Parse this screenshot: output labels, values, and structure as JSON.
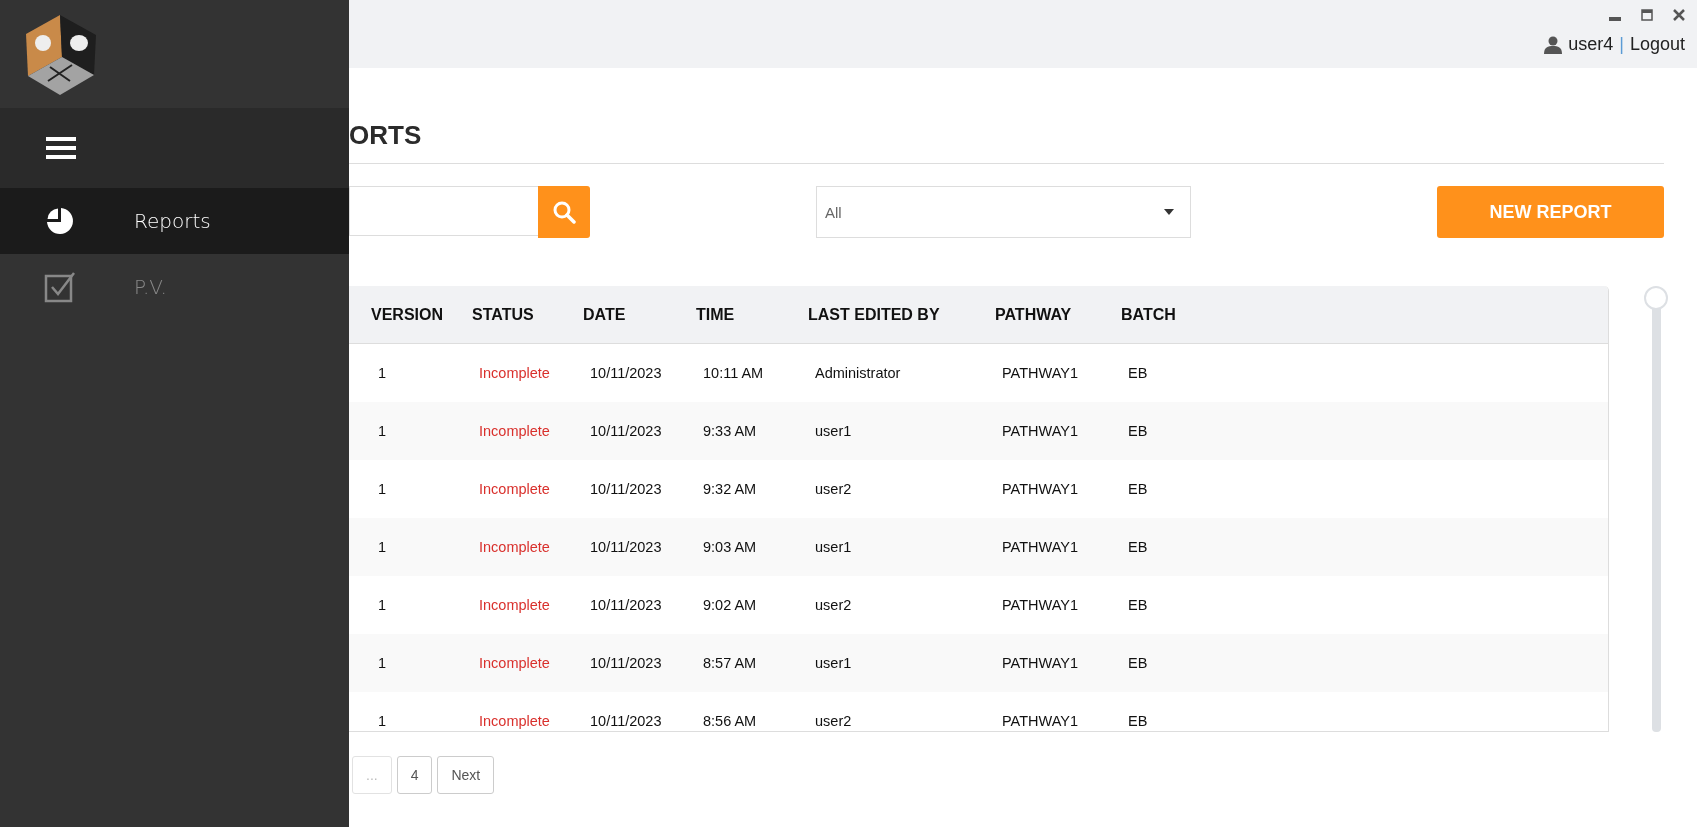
{
  "sidebar": {
    "items": [
      {
        "label": "Reports",
        "kind": "chart",
        "selected": true
      },
      {
        "label": "P.V.",
        "kind": "task",
        "selected": false
      }
    ]
  },
  "topbar": {
    "user": "user4",
    "separator": "|",
    "logout": "Logout"
  },
  "page": {
    "title": "ORTS"
  },
  "filter": {
    "value": "All"
  },
  "new_button": "NEW REPORT",
  "table": {
    "columns": [
      "VERSION",
      "STATUS",
      "DATE",
      "TIME",
      "LAST EDITED BY",
      "PATHWAY",
      "BATCH"
    ],
    "rows": [
      [
        "1",
        "Incomplete",
        "10/11/2023",
        "10:11 AM",
        "Administrator",
        "PATHWAY1",
        "EB"
      ],
      [
        "1",
        "Incomplete",
        "10/11/2023",
        "9:33 AM",
        "user1",
        "PATHWAY1",
        "EB"
      ],
      [
        "1",
        "Incomplete",
        "10/11/2023",
        "9:32 AM",
        "user2",
        "PATHWAY1",
        "EB"
      ],
      [
        "1",
        "Incomplete",
        "10/11/2023",
        "9:03 AM",
        "user1",
        "PATHWAY1",
        "EB"
      ],
      [
        "1",
        "Incomplete",
        "10/11/2023",
        "9:02 AM",
        "user2",
        "PATHWAY1",
        "EB"
      ],
      [
        "1",
        "Incomplete",
        "10/11/2023",
        "8:57 AM",
        "user1",
        "PATHWAY1",
        "EB"
      ],
      [
        "1",
        "Incomplete",
        "10/11/2023",
        "8:56 AM",
        "user2",
        "PATHWAY1",
        "EB"
      ]
    ]
  },
  "pagination": [
    {
      "label": "...",
      "disabled": true
    },
    {
      "label": "4",
      "disabled": false
    },
    {
      "label": "Next",
      "disabled": false
    }
  ]
}
